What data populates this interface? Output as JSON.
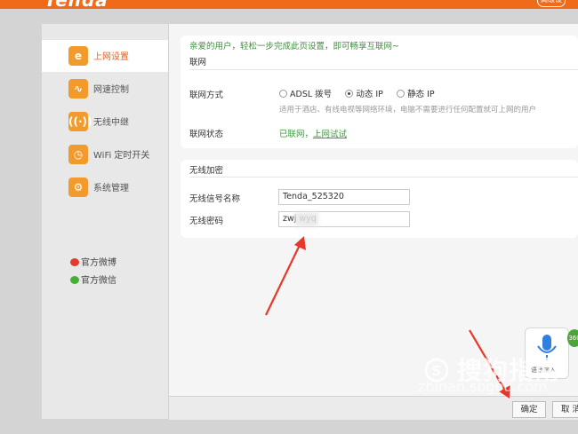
{
  "header": {
    "logo": "Tenda",
    "top_button": "高级设"
  },
  "sidebar": {
    "items": [
      {
        "label": "上网设置",
        "icon": "ie-icon",
        "active": true
      },
      {
        "label": "网速控制",
        "icon": "speed-icon",
        "active": false
      },
      {
        "label": "无线中继",
        "icon": "relay-icon",
        "active": false
      },
      {
        "label": "WiFi 定时开关",
        "icon": "timer-icon",
        "active": false
      },
      {
        "label": "系统管理",
        "icon": "gear-icon",
        "active": false
      }
    ],
    "social": [
      {
        "label": "官方微博",
        "icon": "weibo-icon"
      },
      {
        "label": "官方微信",
        "icon": "wechat-icon"
      }
    ]
  },
  "main": {
    "welcome": "亲爱的用户，轻松一步完成此页设置，即可畅享互联网~",
    "network": {
      "title": "联网",
      "mode_label": "联网方式",
      "options": [
        "ADSL 拨号",
        "动态 IP",
        "静态 IP"
      ],
      "selected": "动态 IP",
      "hint": "适用于酒店、有线电视等网络环境，电脑不需要进行任何配置就可上网的用户",
      "status_label": "联网状态",
      "status_value": "已联网，",
      "status_link": "上网试试"
    },
    "wireless": {
      "title": "无线加密",
      "ssid_label": "无线信号名称",
      "ssid_value": "Tenda_525320",
      "password_label": "无线密码",
      "password_value": "zwj  wyq"
    }
  },
  "buttons": {
    "ok": "确定",
    "cancel": "取 消"
  },
  "watermark": {
    "text": "搜狗指南",
    "url": "zhinan.sogou.com"
  },
  "voice_widget": {
    "label": "语音输入",
    "badge": "360"
  },
  "colors": {
    "brand": "#f06a1a",
    "accent_green": "#3c9a3c",
    "arrow": "#e8372a"
  }
}
